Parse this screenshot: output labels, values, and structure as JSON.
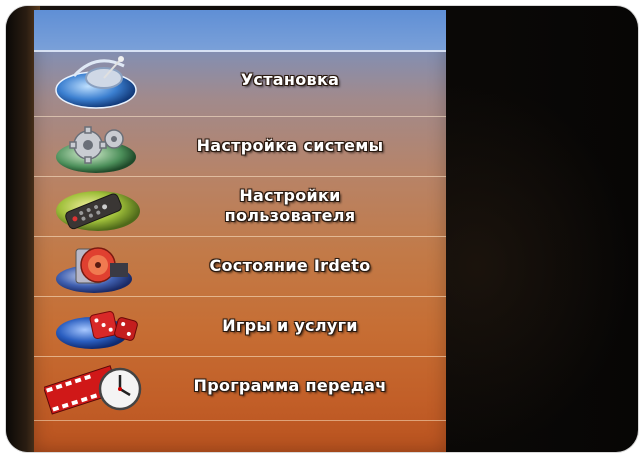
{
  "menu": {
    "items": [
      {
        "label": "Установка",
        "icon": "satellite-globe-icon"
      },
      {
        "label": "Настройка системы",
        "icon": "gears-icon"
      },
      {
        "label": "Настройки пользователя",
        "label_line1": "Настройки",
        "label_line2": "пользователя",
        "icon": "remote-control-icon"
      },
      {
        "label": "Состояние Irdeto",
        "icon": "smartcard-disc-icon"
      },
      {
        "label": "Игры и услуги",
        "icon": "dice-icon"
      },
      {
        "label": "Программа передач",
        "icon": "clock-filmstrip-icon"
      }
    ]
  },
  "colors": {
    "panel_top": "#6d95d0",
    "panel_bottom": "#b9521f",
    "label_text": "#ffffff"
  }
}
